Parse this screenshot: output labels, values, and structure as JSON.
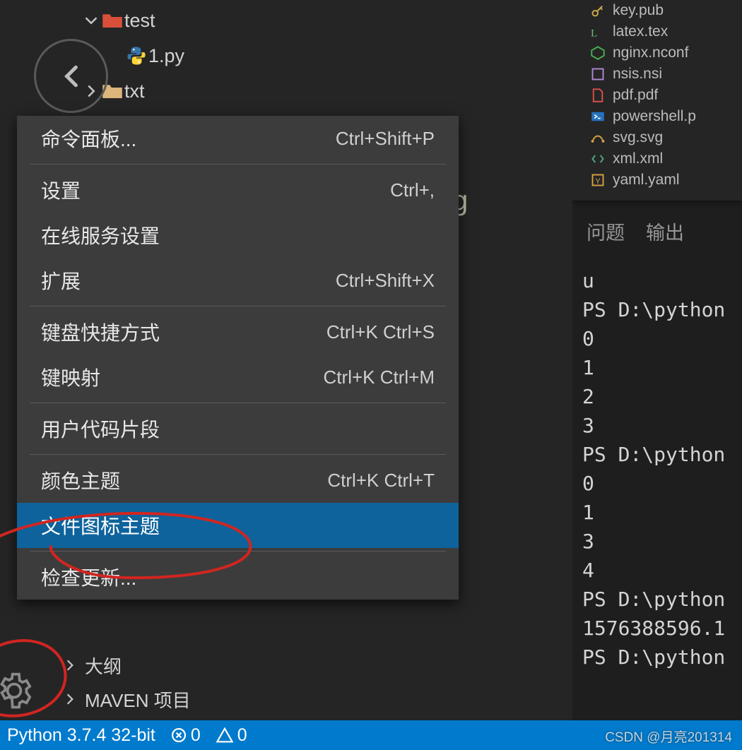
{
  "tree": {
    "folder_test": "test",
    "file_1py": "1.py",
    "folder_txt": "txt"
  },
  "stray_char": "g",
  "menu": {
    "items": [
      {
        "label": "命令面板...",
        "shortcut": "Ctrl+Shift+P"
      },
      {
        "label": "设置",
        "shortcut": "Ctrl+,"
      },
      {
        "label": "在线服务设置",
        "shortcut": ""
      },
      {
        "label": "扩展",
        "shortcut": "Ctrl+Shift+X"
      },
      {
        "label": "键盘快捷方式",
        "shortcut": "Ctrl+K Ctrl+S"
      },
      {
        "label": "键映射",
        "shortcut": "Ctrl+K Ctrl+M"
      },
      {
        "label": "用户代码片段",
        "shortcut": ""
      },
      {
        "label": "颜色主题",
        "shortcut": "Ctrl+K Ctrl+T"
      },
      {
        "label": "文件图标主题",
        "shortcut": ""
      },
      {
        "label": "检查更新...",
        "shortcut": ""
      }
    ]
  },
  "sections": {
    "outline": "大纲",
    "maven": "MAVEN 项目"
  },
  "right_files": [
    {
      "name": "key.pub",
      "icon": "key"
    },
    {
      "name": "latex.tex",
      "icon": "latex"
    },
    {
      "name": "nginx.nconf",
      "icon": "nginx"
    },
    {
      "name": "nsis.nsi",
      "icon": "nsis"
    },
    {
      "name": "pdf.pdf",
      "icon": "pdf"
    },
    {
      "name": "powershell.p",
      "icon": "powershell"
    },
    {
      "name": "svg.svg",
      "icon": "svg"
    },
    {
      "name": "xml.xml",
      "icon": "xml"
    },
    {
      "name": "yaml.yaml",
      "icon": "yaml"
    }
  ],
  "panel_tabs": {
    "problems": "问题",
    "output": "输出"
  },
  "terminal_lines": [
    "u",
    "PS D:\\python",
    "0",
    "1",
    "2",
    "3",
    "PS D:\\python",
    "0",
    "1",
    "3",
    "4",
    "PS D:\\python",
    "1576388596.1",
    "PS D:\\python"
  ],
  "statusbar": {
    "python": "Python 3.7.4 32-bit",
    "errors": "0",
    "warnings": "0"
  },
  "watermark": "CSDN @月亮201314"
}
